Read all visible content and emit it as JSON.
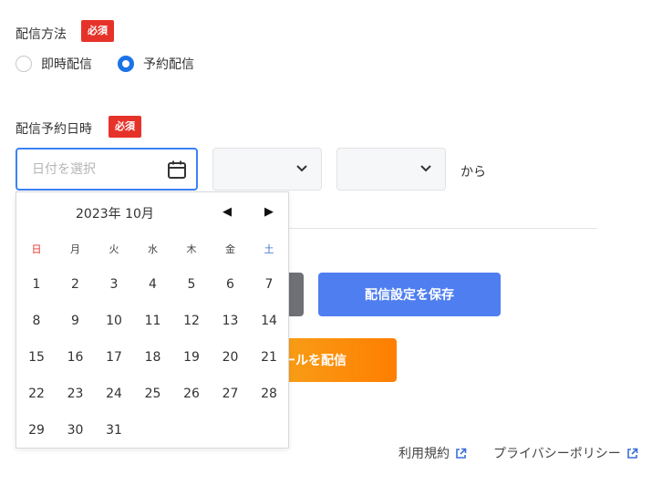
{
  "delivery_method": {
    "label": "配信方法",
    "required_badge": "必須",
    "options": [
      {
        "label": "即時配信",
        "checked": false
      },
      {
        "label": "予約配信",
        "checked": true
      }
    ]
  },
  "schedule": {
    "label": "配信予約日時",
    "required_badge": "必須",
    "date_placeholder": "日付を選択",
    "suffix": "から"
  },
  "calendar": {
    "month_label": "2023年 10月",
    "weekdays": [
      "日",
      "月",
      "火",
      "水",
      "木",
      "金",
      "土"
    ],
    "weeks": [
      [
        "1",
        "2",
        "3",
        "4",
        "5",
        "6",
        "7"
      ],
      [
        "8",
        "9",
        "10",
        "11",
        "12",
        "13",
        "14"
      ],
      [
        "15",
        "16",
        "17",
        "18",
        "19",
        "20",
        "21"
      ],
      [
        "22",
        "23",
        "24",
        "25",
        "26",
        "27",
        "28"
      ],
      [
        "29",
        "30",
        "31"
      ]
    ],
    "prev_icon": "triangle-left-icon",
    "next_icon": "triangle-right-icon"
  },
  "buttons": {
    "save_label": "配信設定を保存",
    "send_label": "ールを配信"
  },
  "footer": {
    "terms": "利用規約",
    "privacy": "プライバシーポリシー"
  },
  "colors": {
    "badge": "#e6332a",
    "accent_blue": "#4f7ef0",
    "radio_blue": "#1a73e8",
    "orange_start": "#f7a31b",
    "orange_end": "#ff7e00"
  }
}
